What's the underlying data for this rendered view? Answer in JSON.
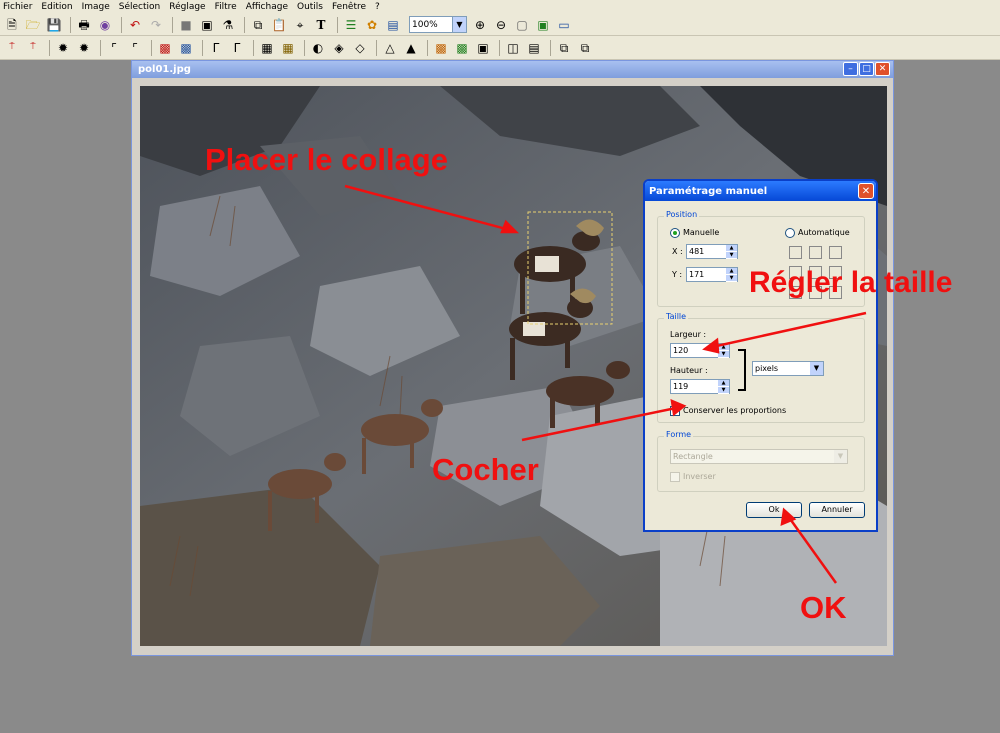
{
  "menu": [
    "Fichier",
    "Edition",
    "Image",
    "Sélection",
    "Réglage",
    "Filtre",
    "Affichage",
    "Outils",
    "Fenêtre",
    "?"
  ],
  "toolbar1": {
    "icons": [
      "new-icon",
      "open-icon",
      "save-icon",
      "print-icon",
      "scan-icon",
      "undo-icon",
      "redo-icon",
      "grey-box-icon",
      "select-icon",
      "person-icon",
      "copy-icon",
      "paste-icon",
      "crop-icon",
      "text-icon",
      "tree-icon",
      "paint-icon",
      "window-icon"
    ],
    "zoom_value": "100%",
    "zoom_icons": [
      "zoom-in-icon",
      "zoom-out-icon",
      "fit-icon",
      "full-icon",
      "screen-icon"
    ]
  },
  "toolbar2_icons": [
    "auto-a-icon",
    "auto-b-icon",
    "sparkle-icon",
    "sparkle-plus-icon",
    "levels-icon",
    "levels-plus-icon",
    "color-minus-icon",
    "color-plus-icon",
    "gamma-minus-icon",
    "gamma-plus-icon",
    "grid-icon",
    "grid-2-icon",
    "contrast-icon",
    "drop-icon",
    "drop-2-icon",
    "sharp-icon",
    "sharp-2-icon",
    "histogram-icon",
    "palette-icon",
    "channels-icon",
    "frame-icon",
    "frame-2-icon",
    "layers-icon",
    "layers-2-icon"
  ],
  "document": {
    "title": "pol01.jpg"
  },
  "dialog": {
    "title": "Paramétrage manuel",
    "position_group": "Position",
    "manual_label": "Manuelle",
    "auto_label": "Automatique",
    "x_label": "X :",
    "x_value": "481",
    "y_label": "Y :",
    "y_value": "171",
    "size_group": "Taille",
    "width_label": "Largeur :",
    "width_value": "120",
    "height_label": "Hauteur :",
    "height_value": "119",
    "unit_value": "pixels",
    "keep_ratio_label": "Conserver les proportions",
    "shape_group": "Forme",
    "shape_value": "Rectangle",
    "invert_label": "Inverser",
    "ok_label": "Ok",
    "cancel_label": "Annuler"
  },
  "annotations": {
    "place": "Placer le collage",
    "size": "Régler la taille",
    "check": "Cocher",
    "ok": "OK"
  },
  "colors": {
    "annotation": "#f01010",
    "desktop": "#8a8a8a",
    "xp_title": "#0648d6"
  }
}
